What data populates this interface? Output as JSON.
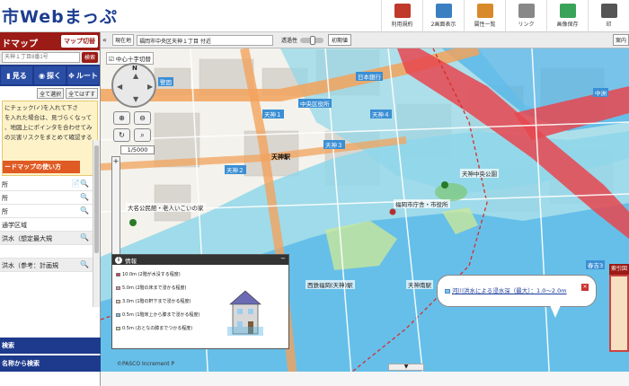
{
  "header": {
    "title": "市Webまっぷ",
    "tools": [
      {
        "label": "利用規約",
        "icon": "book-icon",
        "color": "#c0392b"
      },
      {
        "label": "2画面表示",
        "icon": "split-screen-icon",
        "color": "#3a7fc2"
      },
      {
        "label": "属性一覧",
        "icon": "document-icon",
        "color": "#d88a2a"
      },
      {
        "label": "リンク",
        "icon": "link-icon",
        "color": "#888888"
      },
      {
        "label": "画像保存",
        "icon": "image-save-icon",
        "color": "#3aa35a"
      },
      {
        "label": "印",
        "icon": "print-icon",
        "color": "#555555"
      }
    ]
  },
  "sidebar": {
    "panel_title": "ドマップ",
    "switch_label": "マップ切替",
    "address_placeholder": "天神１丁目8番1号",
    "search_label": "検索",
    "nav": [
      {
        "label": "見る",
        "icon": "eye-icon"
      },
      {
        "label": "探く",
        "icon": "search-icon"
      },
      {
        "label": "ルート",
        "icon": "route-icon"
      }
    ],
    "select_all": "全て選択",
    "deselect_all": "全てはずす",
    "help_lines": [
      "にチェック(✓)を入れて下さ",
      "を入れた場合は、見づらくなって",
      "、地図上にポインタを合わせてみ",
      "の災害リスクをまとめて確認する"
    ],
    "hazard_button": "ードマップの使い方",
    "layers": [
      {
        "label": "所",
        "shaded": false,
        "icons": "📄🔍"
      },
      {
        "label": "所",
        "shaded": false,
        "icons": "🔍"
      },
      {
        "label": "所",
        "shaded": false,
        "icons": "🔍"
      },
      {
        "label": "通学区域",
        "shaded": false,
        "icons": ""
      },
      {
        "label": "洪水（想定最大規",
        "shaded": true,
        "icons": "🔍"
      },
      {
        "label": "",
        "shaded": false,
        "icons": ""
      },
      {
        "label": "洪水（参考：計画規",
        "shaded": true,
        "icons": "🔍"
      }
    ],
    "footer_links": [
      "検索",
      "名称から検索"
    ]
  },
  "map": {
    "location_label": "現在地",
    "location_value": "福岡市中央区天神１丁目 付近",
    "transparency_label": "透過性",
    "transparency_level": 0.55,
    "initial_button": "初期値",
    "display_button": "案内",
    "crosshair_label": "中心十字切替",
    "compass_north": "N",
    "scale": "1/5000",
    "labels": {
      "tenjin_station": "天神駅",
      "tenjin_south": "天神南駅",
      "nishitetsu": "西鉄福岡(天神)駅",
      "kego": "警固",
      "haruyoshi": "春吉3",
      "daimyo": "大名公民館・老人いこいの家",
      "tenjin2": "天神２",
      "tenjin3": "天神３",
      "tenjin4": "天神４",
      "tenjin1": "天神１",
      "nakasu": "中洲",
      "chuo_office": "中央区役所",
      "tenjinpark": "天神中央公園",
      "ginkou": "日本銀行",
      "fukuoka_office": "福岡市庁舎・市役所"
    },
    "info_panel": {
      "title": "情報",
      "legend": [
        {
          "text": "10.0m (2階が水没する程度)",
          "color": "#d63a5c"
        },
        {
          "text": "5.0m (2階の床まで浸かる程度)",
          "color": "#e88ab0"
        },
        {
          "text": "3.0m (1階の軒下まで浸かる程度)",
          "color": "#f2c2a0"
        },
        {
          "text": "0.5m (1階床上から膝まで浸かる程度)",
          "color": "#7ec3f0"
        },
        {
          "text": "0.5m (おとなの膝までつかる程度)",
          "color": "#bfe6a6"
        }
      ]
    },
    "popup": {
      "text": "河川洪水による浸水深（最大）：1.0～2.0m",
      "swatch": "#7ec3f0",
      "close": "×"
    },
    "overview_label": "索引図",
    "attribution": "©PASCO  Increment P",
    "scroll_down": "▼"
  }
}
